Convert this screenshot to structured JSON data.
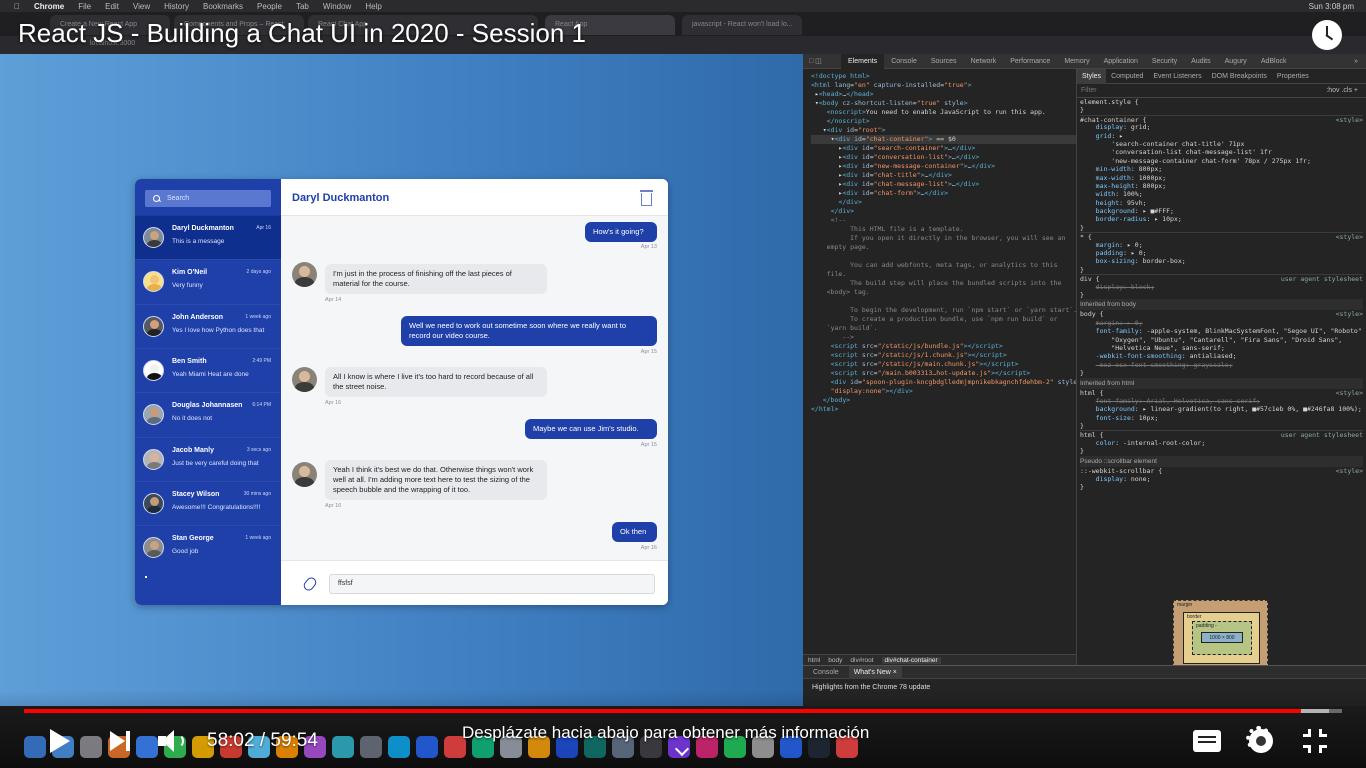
{
  "macbar": {
    "app": "Chrome",
    "menus": [
      "File",
      "Edit",
      "View",
      "History",
      "Bookmarks",
      "People",
      "Tab",
      "Window",
      "Help"
    ],
    "clock": "Sun 3:08 pm"
  },
  "browser": {
    "tabs": [
      "Create a New React App",
      "Components and Props – React",
      "React Chat App",
      "React App",
      "javascript - React won't load lo..."
    ],
    "url": "localhost:3000"
  },
  "video": {
    "title": "React JS - Building a Chat UI in 2020 - Session 1",
    "time": "58:02 / 59:54",
    "progress": 0.969,
    "buffered": 0.99,
    "scroll_hint": "Desplázate hacia abajo para obtener más información"
  },
  "chat": {
    "search_placeholder": "Search",
    "title": "Daryl Duckmanton",
    "input_value": "ffsfsf",
    "conversations": [
      {
        "name": "Daryl Duckmanton",
        "date": "Apr 16",
        "message": "This is a message",
        "active": true,
        "skin": "#c9a27e",
        "shirt": "#3a3a3a",
        "bg": "#7d8a98"
      },
      {
        "name": "Kim O'Neil",
        "date": "2 days ago",
        "message": "Very funny",
        "active": false,
        "skin": "#f2c27b",
        "shirt": "#e8b04a",
        "bg": "#f7e08a"
      },
      {
        "name": "John Anderson",
        "date": "1 week ago",
        "message": "Yes I love how Python does that",
        "active": false,
        "skin": "#d4a07a",
        "shirt": "#222222",
        "bg": "#555a60"
      },
      {
        "name": "Ben Smith",
        "date": "2:49 PM",
        "message": "Yeah Miami Heat are done",
        "active": false,
        "skin": "#f1f1f1",
        "shirt": "#111111",
        "bg": "#ffffff"
      },
      {
        "name": "Douglas Johannasen",
        "date": "6:14 PM",
        "message": "No it does not",
        "active": false,
        "skin": "#c89b7b",
        "shirt": "#5d6b7a",
        "bg": "#9aa6b2"
      },
      {
        "name": "Jacob Manly",
        "date": "3 secs ago",
        "message": "Just be very careful doing that",
        "active": false,
        "skin": "#d8b49a",
        "shirt": "#7a7a7a",
        "bg": "#b5b5b5"
      },
      {
        "name": "Stacey Wilson",
        "date": "30 mins ago",
        "message": "Awesome!!! Congratulations!!!!",
        "active": false,
        "skin": "#c49c78",
        "shirt": "#1d2a38",
        "bg": "#3c4a58"
      },
      {
        "name": "Stan George",
        "date": "1 week ago",
        "message": "Good job",
        "active": false,
        "skin": "#caa181",
        "shirt": "#5a5a5a",
        "bg": "#8d8d8d"
      }
    ],
    "messages": [
      {
        "side": "out",
        "text": "How's it going?",
        "date": "Apr 13"
      },
      {
        "side": "in",
        "text": "I'm just in the process of finishing off the last pieces of material for the course.",
        "date": "Apr 14"
      },
      {
        "side": "out",
        "text": "Well we need to work out sometime soon where we really want to record our video course.",
        "date": "Apr 15"
      },
      {
        "side": "in",
        "text": "All I know is where I live it's too hard to record because of all the street noise.",
        "date": "Apr 16"
      },
      {
        "side": "out",
        "text": "Maybe we can use Jim's studio.",
        "date": "Apr 15"
      },
      {
        "side": "in",
        "text": "Yeah I think it's best we do that. Otherwise things won't work well at all. I'm adding more text here to test the sizing of the speech bubble and the wrapping of it too.",
        "date": "Apr 16"
      },
      {
        "side": "out",
        "text": "Ok then",
        "date": "Apr 16"
      }
    ]
  },
  "devtools": {
    "tabs": [
      "Elements",
      "Console",
      "Sources",
      "Network",
      "Performance",
      "Memory",
      "Application",
      "Security",
      "Audits",
      "Augury",
      "AdBlock"
    ],
    "styles_tabs": [
      "Styles",
      "Computed",
      "Event Listeners",
      "DOM Breakpoints",
      "Properties"
    ],
    "filter_placeholder": "Filter",
    "filter_tools": ":hov .cls +",
    "breadcrumb": [
      "html",
      "body",
      "div#root",
      "div#chat-container"
    ],
    "drawer_tabs": [
      "Console",
      "What's New ×"
    ],
    "drawer_text": "Highlights from the Chrome 78 update",
    "box_model": {
      "margin": "margin",
      "border": "border",
      "padding": "padding -",
      "content": "1000 × 800"
    }
  }
}
